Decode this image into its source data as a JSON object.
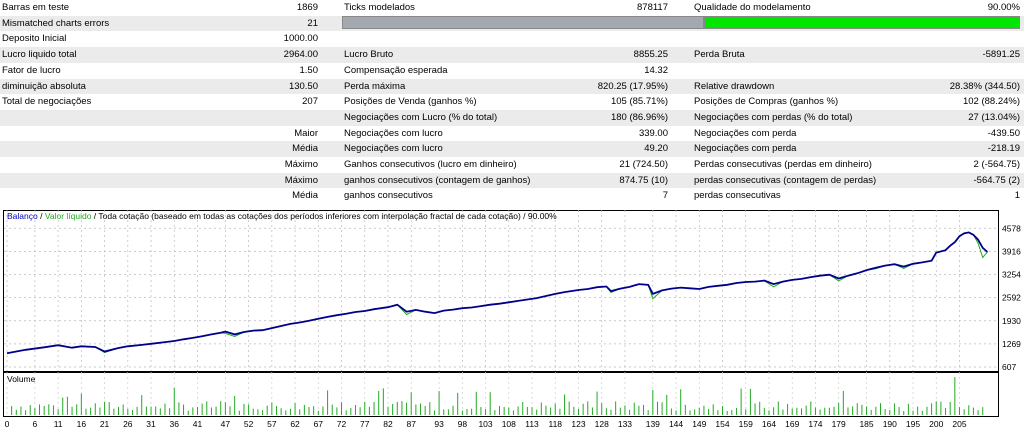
{
  "stats": {
    "rows": [
      {
        "l1": "Barras em teste",
        "v1": "1869",
        "l2": "Ticks modelados",
        "v2": "878117",
        "l3": "Qualidade do modelamento",
        "v3": "90.00%"
      },
      {
        "l1": "Mismatched charts errors",
        "v1": "21",
        "l2": "",
        "v2": "",
        "l3": "",
        "v3": ""
      },
      {
        "l1": "Deposito Inicial",
        "v1": "1000.00",
        "l2": "",
        "v2": "",
        "l3": "",
        "v3": ""
      },
      {
        "l1": "Lucro liquido total",
        "v1": "2964.00",
        "l2": "Lucro Bruto",
        "v2": "8855.25",
        "l3": "Perda Bruta",
        "v3": "-5891.25"
      },
      {
        "l1": "Fator de lucro",
        "v1": "1.50",
        "l2": "Compensação esperada",
        "v2": "14.32",
        "l3": "",
        "v3": ""
      },
      {
        "l1": "diminuição absoluta",
        "v1": "130.50",
        "l2": "Perda máxima",
        "v2": "820.25 (17.95%)",
        "l3": "Relative drawdown",
        "v3": "28.38% (344.50)"
      },
      {
        "l1": "Total de negociações",
        "v1": "207",
        "l2": "Posições de Venda (ganhos %)",
        "v2": "105 (85.71%)",
        "l3": "Posições de Compras (ganhos %)",
        "v3": "102 (88.24%)"
      },
      {
        "l1": "",
        "v1": "",
        "l2": "Negociações com Lucro (% do total)",
        "v2": "180 (86.96%)",
        "l3": "Negociações com perdas (% do total)",
        "v3": "27 (13.04%)"
      },
      {
        "l1": "",
        "v1": "Maior",
        "l2": "Negociações com lucro",
        "v2": "339.00",
        "l3": "Negociações com perda",
        "v3": "-439.50"
      },
      {
        "l1": "",
        "v1": "Média",
        "l2": "Negociações com lucro",
        "v2": "49.20",
        "l3": "Negociações com perda",
        "v3": "-218.19"
      },
      {
        "l1": "",
        "v1": "Máximo",
        "l2": "Ganhos consecutivos (lucro em dinheiro)",
        "v2": "21 (724.50)",
        "l3": "Perdas consecutivas (perdas em dinheiro)",
        "v3": "2 (-564.75)"
      },
      {
        "l1": "",
        "v1": "Máximo",
        "l2": "ganhos consecutivos (contagem de ganhos)",
        "v2": "874.75 (10)",
        "l3": "perdas consecutivas (contagem de perdas)",
        "v3": "-564.75 (2)"
      },
      {
        "l1": "",
        "v1": "Média",
        "l2": "ganhos consecutivos",
        "v2": "7",
        "l3": "perdas consecutivas",
        "v3": "1"
      }
    ],
    "modeling_quality": 0.9
  },
  "colors": {
    "balance": "#00008b",
    "equity": "#22aa22",
    "volume": "#22aa22",
    "quality_bar": "#00e600",
    "quality_track": "#a4a9b0",
    "label_blue": "#0000c0"
  },
  "chart_data": {
    "type": "line",
    "legend_balance": "Balanço",
    "legend_equity": "Valor líquido",
    "legend_rest": "Toda cotação (baseado em todas as cotações dos períodos inferiores com interpolação fractal de cada cotação) / 90.00%",
    "yticks": [
      "4578",
      "3916",
      "3254",
      "2592",
      "1930",
      "1269",
      "607"
    ],
    "ytick_values": [
      4578,
      3916,
      3254,
      2592,
      1930,
      1269,
      607
    ],
    "xticks": [
      "0",
      "6",
      "11",
      "16",
      "21",
      "26",
      "31",
      "36",
      "41",
      "47",
      "52",
      "57",
      "62",
      "67",
      "72",
      "77",
      "82",
      "87",
      "93",
      "98",
      "103",
      "108",
      "113",
      "118",
      "123",
      "128",
      "133",
      "139",
      "144",
      "149",
      "154",
      "159",
      "164",
      "169",
      "174",
      "179",
      "185",
      "190",
      "195",
      "200",
      "205"
    ],
    "ylim": [
      607,
      4700
    ],
    "balance": [
      [
        0,
        1000
      ],
      [
        4,
        1100
      ],
      [
        8,
        1170
      ],
      [
        11,
        1230
      ],
      [
        14,
        1160
      ],
      [
        16,
        1200
      ],
      [
        19,
        1180
      ],
      [
        21,
        1050
      ],
      [
        24,
        1150
      ],
      [
        26,
        1200
      ],
      [
        29,
        1240
      ],
      [
        31,
        1270
      ],
      [
        34,
        1320
      ],
      [
        36,
        1350
      ],
      [
        38,
        1400
      ],
      [
        40,
        1440
      ],
      [
        42,
        1490
      ],
      [
        44,
        1540
      ],
      [
        46,
        1590
      ],
      [
        47,
        1620
      ],
      [
        49,
        1540
      ],
      [
        51,
        1610
      ],
      [
        53,
        1650
      ],
      [
        55,
        1660
      ],
      [
        57,
        1720
      ],
      [
        59,
        1780
      ],
      [
        61,
        1840
      ],
      [
        63,
        1880
      ],
      [
        65,
        1930
      ],
      [
        67,
        1990
      ],
      [
        69,
        2040
      ],
      [
        71,
        2090
      ],
      [
        73,
        2130
      ],
      [
        75,
        2180
      ],
      [
        77,
        2210
      ],
      [
        79,
        2260
      ],
      [
        82,
        2320
      ],
      [
        84,
        2390
      ],
      [
        86,
        2190
      ],
      [
        88,
        2240
      ],
      [
        90,
        2190
      ],
      [
        92,
        2150
      ],
      [
        94,
        2220
      ],
      [
        96,
        2250
      ],
      [
        98,
        2290
      ],
      [
        100,
        2310
      ],
      [
        102,
        2350
      ],
      [
        104,
        2390
      ],
      [
        106,
        2420
      ],
      [
        108,
        2460
      ],
      [
        110,
        2500
      ],
      [
        112,
        2540
      ],
      [
        114,
        2580
      ],
      [
        116,
        2640
      ],
      [
        118,
        2700
      ],
      [
        120,
        2750
      ],
      [
        123,
        2810
      ],
      [
        125,
        2840
      ],
      [
        127,
        2890
      ],
      [
        129,
        2910
      ],
      [
        130,
        2780
      ],
      [
        132,
        2850
      ],
      [
        134,
        2900
      ],
      [
        136,
        2980
      ],
      [
        138,
        2960
      ],
      [
        139,
        2700
      ],
      [
        141,
        2800
      ],
      [
        143,
        2850
      ],
      [
        145,
        2880
      ],
      [
        147,
        2860
      ],
      [
        149,
        2840
      ],
      [
        151,
        2900
      ],
      [
        153,
        2930
      ],
      [
        155,
        2960
      ],
      [
        157,
        3010
      ],
      [
        159,
        3040
      ],
      [
        161,
        3050
      ],
      [
        163,
        3080
      ],
      [
        165,
        2980
      ],
      [
        167,
        3050
      ],
      [
        169,
        3100
      ],
      [
        171,
        3130
      ],
      [
        173,
        3180
      ],
      [
        175,
        3220
      ],
      [
        177,
        3250
      ],
      [
        179,
        3140
      ],
      [
        181,
        3220
      ],
      [
        183,
        3290
      ],
      [
        185,
        3380
      ],
      [
        187,
        3450
      ],
      [
        189,
        3510
      ],
      [
        191,
        3550
      ],
      [
        193,
        3480
      ],
      [
        195,
        3560
      ],
      [
        197,
        3600
      ],
      [
        199,
        3650
      ],
      [
        200,
        3880
      ],
      [
        202,
        3950
      ],
      [
        203,
        4080
      ],
      [
        204,
        4180
      ],
      [
        205,
        4350
      ],
      [
        206,
        4430
      ],
      [
        207,
        4460
      ],
      [
        208,
        4390
      ],
      [
        209,
        4250
      ],
      [
        210,
        4020
      ],
      [
        211,
        3900
      ]
    ],
    "equity": [
      [
        0,
        1000
      ],
      [
        4,
        1100
      ],
      [
        8,
        1170
      ],
      [
        11,
        1230
      ],
      [
        14,
        1160
      ],
      [
        16,
        1200
      ],
      [
        19,
        1180
      ],
      [
        21,
        1020
      ],
      [
        24,
        1150
      ],
      [
        26,
        1200
      ],
      [
        29,
        1240
      ],
      [
        31,
        1270
      ],
      [
        34,
        1320
      ],
      [
        36,
        1350
      ],
      [
        38,
        1400
      ],
      [
        40,
        1440
      ],
      [
        42,
        1490
      ],
      [
        44,
        1540
      ],
      [
        46,
        1590
      ],
      [
        47,
        1570
      ],
      [
        49,
        1480
      ],
      [
        51,
        1610
      ],
      [
        53,
        1650
      ],
      [
        55,
        1660
      ],
      [
        57,
        1720
      ],
      [
        59,
        1780
      ],
      [
        61,
        1840
      ],
      [
        63,
        1880
      ],
      [
        65,
        1930
      ],
      [
        67,
        1990
      ],
      [
        69,
        2040
      ],
      [
        71,
        2090
      ],
      [
        73,
        2130
      ],
      [
        75,
        2180
      ],
      [
        77,
        2210
      ],
      [
        79,
        2260
      ],
      [
        82,
        2320
      ],
      [
        84,
        2390
      ],
      [
        86,
        2110
      ],
      [
        88,
        2240
      ],
      [
        90,
        2190
      ],
      [
        92,
        2150
      ],
      [
        94,
        2220
      ],
      [
        96,
        2250
      ],
      [
        98,
        2290
      ],
      [
        100,
        2310
      ],
      [
        102,
        2350
      ],
      [
        104,
        2390
      ],
      [
        106,
        2420
      ],
      [
        108,
        2460
      ],
      [
        110,
        2500
      ],
      [
        112,
        2540
      ],
      [
        114,
        2580
      ],
      [
        116,
        2640
      ],
      [
        118,
        2700
      ],
      [
        120,
        2750
      ],
      [
        123,
        2810
      ],
      [
        125,
        2840
      ],
      [
        127,
        2890
      ],
      [
        129,
        2910
      ],
      [
        130,
        2740
      ],
      [
        132,
        2850
      ],
      [
        134,
        2900
      ],
      [
        136,
        2980
      ],
      [
        138,
        2960
      ],
      [
        139,
        2560
      ],
      [
        141,
        2800
      ],
      [
        143,
        2850
      ],
      [
        145,
        2880
      ],
      [
        147,
        2860
      ],
      [
        149,
        2840
      ],
      [
        151,
        2900
      ],
      [
        153,
        2930
      ],
      [
        155,
        2960
      ],
      [
        157,
        3010
      ],
      [
        159,
        3040
      ],
      [
        161,
        3050
      ],
      [
        163,
        3080
      ],
      [
        165,
        2900
      ],
      [
        167,
        3050
      ],
      [
        169,
        3100
      ],
      [
        171,
        3130
      ],
      [
        173,
        3180
      ],
      [
        175,
        3220
      ],
      [
        177,
        3250
      ],
      [
        179,
        3070
      ],
      [
        181,
        3220
      ],
      [
        183,
        3290
      ],
      [
        185,
        3380
      ],
      [
        187,
        3420
      ],
      [
        189,
        3510
      ],
      [
        191,
        3550
      ],
      [
        193,
        3430
      ],
      [
        195,
        3560
      ],
      [
        197,
        3600
      ],
      [
        199,
        3650
      ],
      [
        200,
        3880
      ],
      [
        202,
        3950
      ],
      [
        203,
        4080
      ],
      [
        204,
        4180
      ],
      [
        205,
        4350
      ],
      [
        206,
        4430
      ],
      [
        207,
        4460
      ],
      [
        208,
        4390
      ],
      [
        209,
        4150
      ],
      [
        210,
        3740
      ],
      [
        211,
        3900
      ]
    ],
    "volume_label": "Volume"
  }
}
